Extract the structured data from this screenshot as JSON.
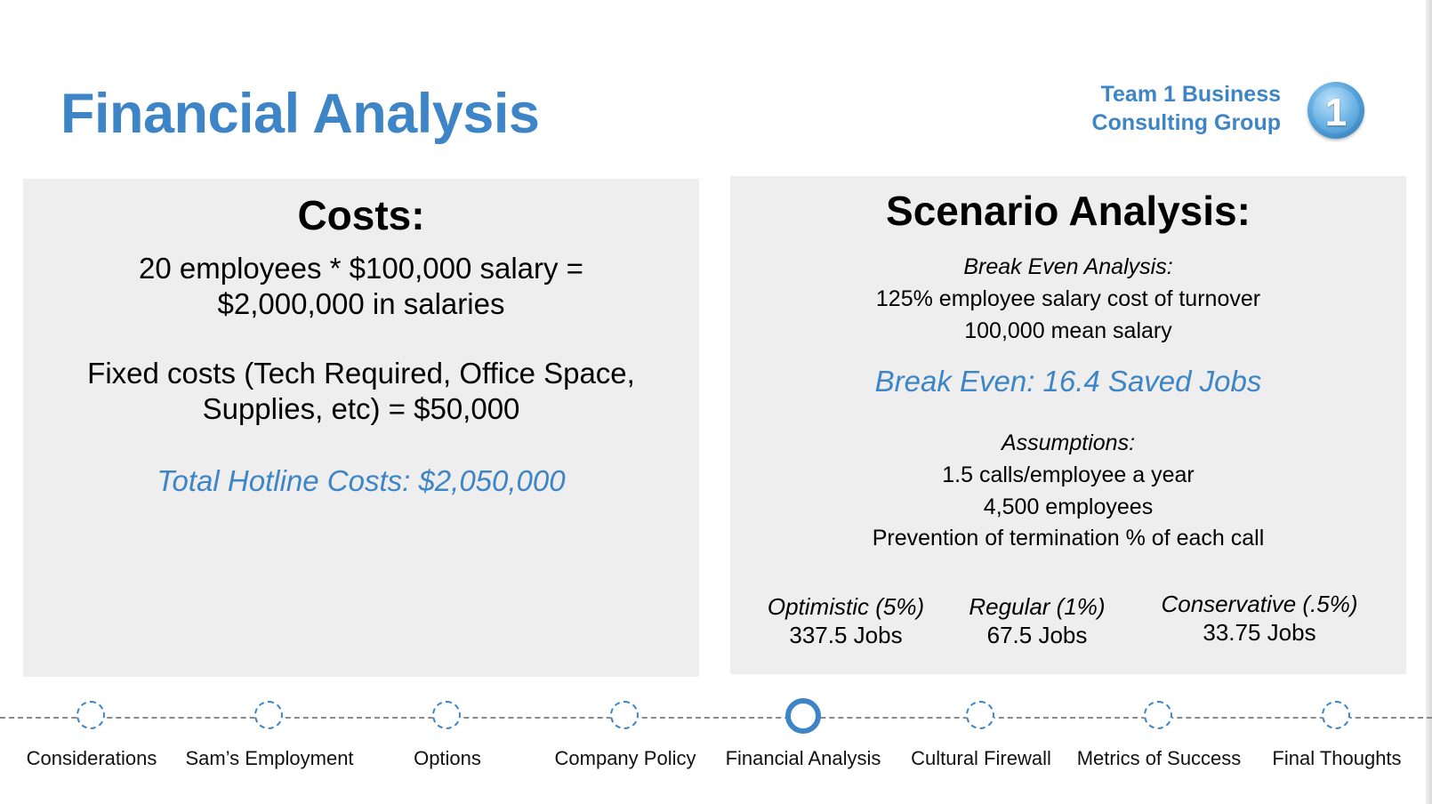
{
  "header": {
    "title": "Financial Analysis",
    "brand_line1": "Team 1 Business",
    "brand_line2": "Consulting Group",
    "logo_text": "1"
  },
  "costs": {
    "heading": "Costs:",
    "salary_line1": "20 employees * $100,000 salary =",
    "salary_line2": "$2,000,000 in salaries",
    "fixed_line1": "Fixed costs (Tech Required, Office Space,",
    "fixed_line2": "Supplies, etc) = $50,000",
    "total": "Total Hotline Costs: $2,050,000"
  },
  "scenario": {
    "heading": "Scenario Analysis:",
    "breakeven_label": "Break Even Analysis:",
    "breakeven_line1": "125% employee salary cost of turnover",
    "breakeven_line2": "100,000 mean salary",
    "breakeven_result": "Break Even: 16.4 Saved Jobs",
    "assumptions_label": "Assumptions:",
    "assumption_1": "1.5 calls/employee a year",
    "assumption_2": "4,500 employees",
    "assumption_3": "Prevention of termination % of each call",
    "cases": [
      {
        "label": "Optimistic (5%)",
        "value": "337.5 Jobs"
      },
      {
        "label": "Regular (1%)",
        "value": "67.5 Jobs"
      },
      {
        "label": "Conservative (.5%)",
        "value": "33.75 Jobs"
      }
    ]
  },
  "timeline": {
    "active_index": 4,
    "steps": [
      {
        "label": "Considerations"
      },
      {
        "label": "Sam’s Employment"
      },
      {
        "label": "Options"
      },
      {
        "label": "Company Policy"
      },
      {
        "label": "Financial Analysis"
      },
      {
        "label": "Cultural Firewall"
      },
      {
        "label": "Metrics of Success"
      },
      {
        "label": "Final Thoughts"
      }
    ]
  },
  "colors": {
    "accent": "#3d85c6",
    "panel_bg": "#eeeeee"
  }
}
